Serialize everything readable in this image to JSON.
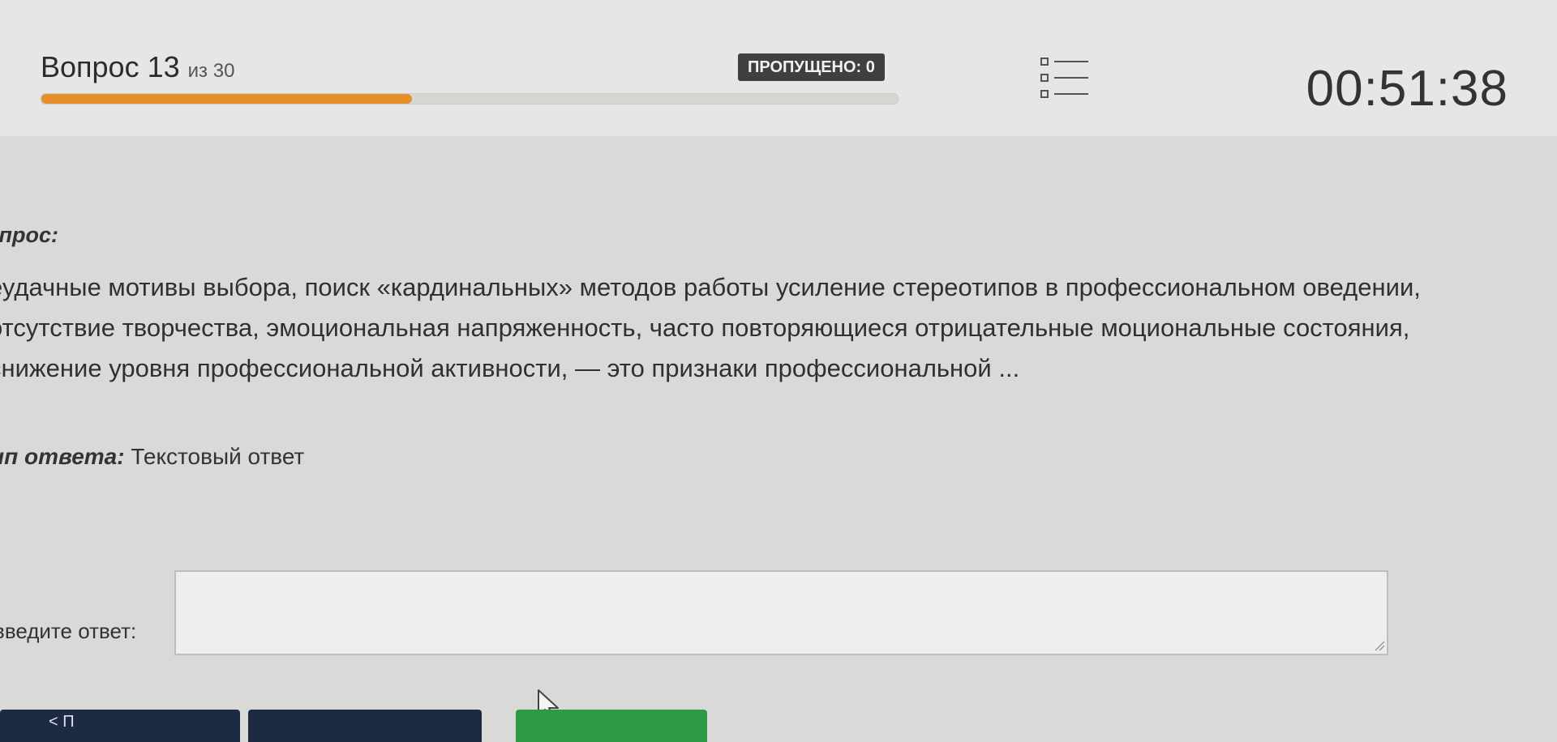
{
  "header": {
    "question_word": "Вопрос 13",
    "question_of": "из 30",
    "progress_fraction": 0.433,
    "skipped_label": "ПРОПУЩЕНО: 0",
    "timer": "00:51:38",
    "list_icon": "list-icon"
  },
  "question": {
    "label": "опрос:",
    "text": "еудачные мотивы выбора, поиск «кардинальных» методов работы усиление стереотипов в профессиональном оведении, отсутствие творчества, эмоциональная напряженность, часто повторяющиеся отрицательные моциональные состояния, снижение уровня профессиональной активности, — это признаки профессиональной ...",
    "answer_type_label": "ип ответа:",
    "answer_type_value": "Текстовый ответ"
  },
  "answer": {
    "label": "введите ответ:",
    "value": ""
  },
  "nav": {
    "prev_label": "< П"
  },
  "colors": {
    "progress": "#e58f2a",
    "badge_bg": "#3f3f3f",
    "nav_dark": "#1d2a44",
    "nav_green": "#2e9a48"
  }
}
